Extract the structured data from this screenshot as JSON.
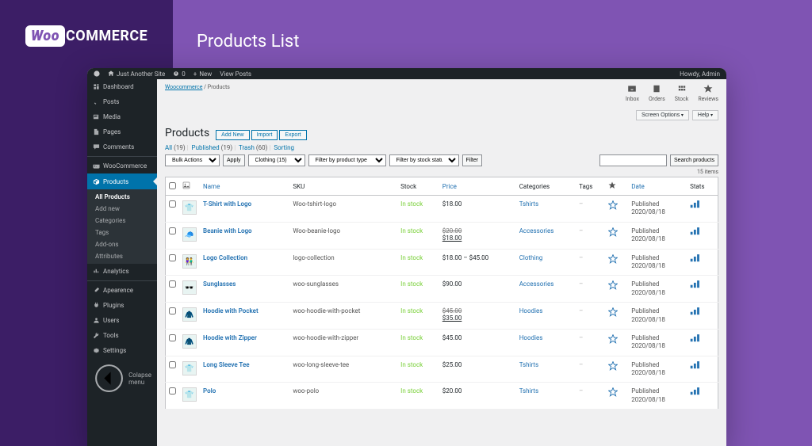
{
  "frame": {
    "logo_pre": "Woo",
    "logo_post": "COMMERCE",
    "title": "Products List"
  },
  "adminbar": {
    "site": "Just Another Site",
    "comments": "0",
    "new": "New",
    "view": "View Posts",
    "howdy": "Howdy, Admin"
  },
  "sidebar": {
    "items": [
      {
        "icon": "dash",
        "label": "Dashboard"
      },
      {
        "icon": "pin",
        "label": "Posts"
      },
      {
        "icon": "media",
        "label": "Media"
      },
      {
        "icon": "page",
        "label": "Pages"
      },
      {
        "icon": "comment",
        "label": "Comments"
      },
      {
        "icon": "woo",
        "label": "WooCommerce"
      },
      {
        "icon": "prod",
        "label": "Products",
        "active": true
      },
      {
        "icon": "analytics",
        "label": "Analytics"
      },
      {
        "icon": "brush",
        "label": "Apearence"
      },
      {
        "icon": "plug",
        "label": "Plugins"
      },
      {
        "icon": "user",
        "label": "Users"
      },
      {
        "icon": "tool",
        "label": "Tools"
      },
      {
        "icon": "gear",
        "label": "Settings"
      }
    ],
    "sub": [
      "All Products",
      "Add new",
      "Categories",
      "Tags",
      "Add-ons",
      "Attributes"
    ],
    "collapse": "Colapse menu"
  },
  "topicons": [
    {
      "icon": "inbox",
      "label": "Inbox"
    },
    {
      "icon": "orders",
      "label": "Orders"
    },
    {
      "icon": "stock",
      "label": "Stock"
    },
    {
      "icon": "star",
      "label": "Reviews"
    }
  ],
  "topbtns": {
    "screen": "Screen Options",
    "help": "Help"
  },
  "bc": {
    "woo": "Woocommerce",
    "sep": " / ",
    "page": "Products"
  },
  "page": {
    "title": "Products",
    "addnew": "Add New",
    "import": "Import",
    "export": "Export",
    "views": {
      "all": "All",
      "all_c": "(19)",
      "pub": "Published",
      "pub_c": "(19)",
      "trash": "Trash",
      "trash_c": "(60)",
      "sort": "Sorting"
    },
    "filters": {
      "bulk": "Bulk Actions",
      "apply": "Apply",
      "cat": "Clothing  (15)",
      "type": "Filter by product type",
      "stock": "Filter by stock status",
      "filter": "Filter",
      "search_placeholder": "",
      "search_btn": "Search products"
    },
    "items": "15 items",
    "columns": [
      "Name",
      "SKU",
      "Stock",
      "Price",
      "Categories",
      "Tags",
      "",
      "Date",
      "Stats"
    ],
    "rows": [
      {
        "name": "T-Shirt with Logo",
        "sku": "Woo-tshirt-logo",
        "stock": "In stock",
        "price": "$18.00",
        "cat": "Tshirts",
        "date": "2020/08/18"
      },
      {
        "name": "Beanie with Logo",
        "sku": "Woo-beanie-logo",
        "stock": "In stock",
        "price_strike": "$20.00",
        "price_under": "$18.00",
        "cat": "Accessories",
        "date": "2020/08/18"
      },
      {
        "name": "Logo Collection",
        "sku": "logo-collection",
        "stock": "In stock",
        "price": "$18.00 – $45.00",
        "cat": "Clothing",
        "date": "2020/08/18"
      },
      {
        "name": "Sunglasses",
        "sku": "woo-sunglasses",
        "stock": "In stock",
        "price": "$90.00",
        "cat": "Accessories",
        "date": "2020/08/18"
      },
      {
        "name": "Hoodie with Pocket",
        "sku": "woo-hoodie-with-pocket",
        "stock": "In stock",
        "price_strike": "$45.00",
        "price_under": "$35.00",
        "cat": "Hoodies",
        "date": "2020/08/18"
      },
      {
        "name": "Hoodie with Zipper",
        "sku": "woo-hoodie-with-zipper",
        "stock": "In stock",
        "price": "$45.00",
        "cat": "Hoodies",
        "date": "2020/08/18"
      },
      {
        "name": "Long Sleeve Tee",
        "sku": "woo-long-sleeve-tee",
        "stock": "In stock",
        "price": "$25.00",
        "cat": "Tshirts",
        "date": "2020/08/18"
      },
      {
        "name": "Polo",
        "sku": "woo-polo",
        "stock": "In stock",
        "price": "$20.00",
        "cat": "Tshirts",
        "date": "2020/08/18"
      }
    ],
    "published": "Published"
  }
}
